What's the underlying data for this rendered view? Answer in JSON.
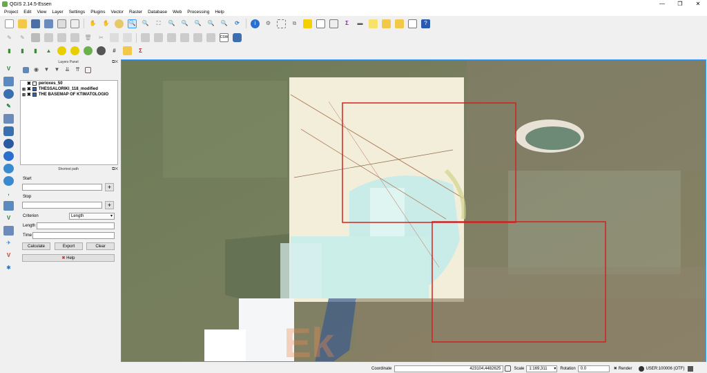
{
  "window": {
    "title": "QGIS 2.14.5-Essen",
    "min": "—",
    "max": "❐",
    "close": "✕"
  },
  "menu": [
    "Project",
    "Edit",
    "View",
    "Layer",
    "Settings",
    "Plugins",
    "Vector",
    "Raster",
    "Database",
    "Web",
    "Processing",
    "Help"
  ],
  "layers_panel": {
    "title": "Layers Panel",
    "layers": [
      {
        "name": "perioxes_50",
        "checked": "✖",
        "color": "#ffffff"
      },
      {
        "name": "THESSALORIKI_118_modified",
        "checked": "✖",
        "color": "#3a64a8"
      },
      {
        "name": "THE BASEMAP OF KTIMATOLOGIO",
        "checked": "✖",
        "color": "#3a64a8"
      }
    ]
  },
  "shortest_path": {
    "title": "Shortest path",
    "start_label": "Start",
    "stop_label": "Stop",
    "criterion_label": "Criterion",
    "criterion_value": "Length",
    "length_label": "Length",
    "time_label": "Time",
    "calculate": "Calculate",
    "export": "Export",
    "clear": "Clear",
    "help": "Help",
    "plus": "+"
  },
  "status": {
    "coordinate_label": "Coordinate",
    "coordinate_value": "423104,4482625",
    "scale_label": "Scale",
    "scale_value": "1:169,311",
    "rotation_label": "Rotation",
    "rotation_value": "0.0",
    "render_label": "Render",
    "crs": "USER:100006 (OTF)"
  },
  "map": {
    "watermark": "Ek"
  }
}
